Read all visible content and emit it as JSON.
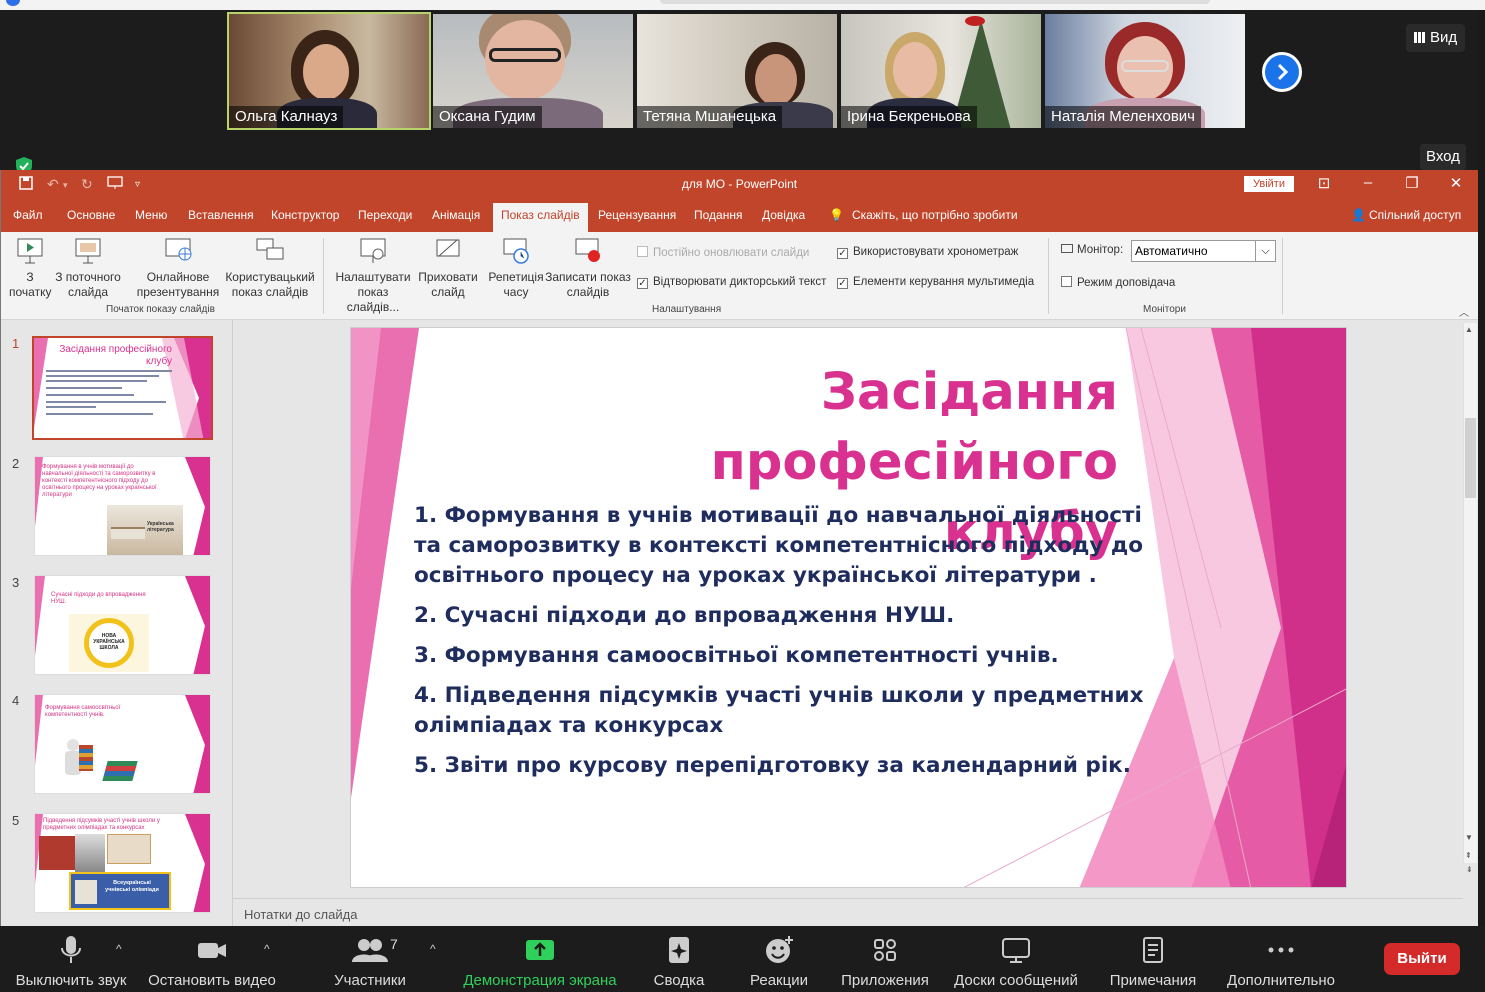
{
  "zoom": {
    "participants": [
      {
        "name": "Ольга Калнауз",
        "active": true
      },
      {
        "name": "Оксана Гудим",
        "active": false
      },
      {
        "name": "Тетяна Мшанецька",
        "active": false
      },
      {
        "name": "Ірина  Бекреньова",
        "active": false
      },
      {
        "name": "Наталія Меленхович",
        "active": false
      }
    ],
    "view_label": "Вид",
    "signin_label": "Вход",
    "toolbar": {
      "mute": "Выключить звук",
      "stop_video": "Остановить видео",
      "participants": "Участники",
      "participants_count": "7",
      "share": "Демонстрация экрана",
      "summary": "Сводка",
      "reactions": "Реакции",
      "apps": "Приложения",
      "boards": "Доски сообщений",
      "notes": "Примечания",
      "more": "Дополнительно",
      "leave": "Выйти"
    }
  },
  "powerpoint": {
    "window_title": "для МО  -  PowerPoint",
    "signin_label": "Увійти",
    "tabs": [
      "Файл",
      "Основне",
      "Меню",
      "Вставлення",
      "Конструктор",
      "Переходи",
      "Анімація",
      "Показ слайдів",
      "Рецензування",
      "Подання",
      "Довідка"
    ],
    "selected_tab": "Показ слайдів",
    "tell_me": "Скажіть, що потрібно зробити",
    "share": "Спільний доступ",
    "ribbon": {
      "from_start": "З\nпочатку",
      "from_current": "З поточного\nслайда",
      "online": "Онлайнове\nпрезентування",
      "custom": "Користувацький\nпоказ слайдів",
      "group_start": "Початок показу слайдів",
      "setup": "Налаштувати\nпоказ слайдів...",
      "hide": "Приховати\nслайд",
      "rehearse": "Репетиція\nчасу",
      "record": "Записати показ\nслайдів",
      "always_update": "Постійно оновлювати слайди",
      "play_narration": "Відтворювати дикторський текст",
      "use_timings": "Використовувати хронометраж",
      "media_controls": "Елементи керування мультимедіа",
      "group_setup": "Налаштування",
      "monitor_label": "Монітор:",
      "monitor_value": "Автоматично",
      "presenter_view": "Режим доповідача",
      "group_monitors": "Монітори"
    },
    "slide_numbers": [
      "1",
      "2",
      "3",
      "4",
      "5"
    ],
    "thumbs": {
      "t1_title": "Засідання професійного клубу",
      "t2": "Формування в учнів мотивації до навчальної діяльності та саморозвитку в контексті компетентнісного підходу до освітнього процесу на уроках української літератури",
      "t2_book": "Українська література",
      "t3": "Сучасні підходи до впровадження НУШ.",
      "t3_logo": "НОВА УКРАЇНСЬКА ШКОЛА",
      "t4": "Формування самоосвітньої компетентності учнів.",
      "t5": "Підведення підсумків участі учнів школи у предметних олімпіадах та конкурсах",
      "t5_badge": "Всеукраїнські учнівські олімпіади"
    },
    "slide": {
      "title_line1": "Засідання професійного",
      "title_line2": "клубу",
      "items": [
        "1.  Формування в учнів мотивації до навчальної діяльності та саморозвитку в контексті компетентнісного підходу до освітнього  процесу на уроках української літератури .",
        "2.  Сучасні підходи до впровадження НУШ.",
        "3.  Формування самоосвітньої компетентності учнів.",
        "4.  Підведення підсумків участі учнів школи у предметних олімпіадах та конкурсах",
        "5.  Звіти про курсову перепідготовку за календарний рік."
      ]
    },
    "notes_placeholder": "Нотатки до слайда"
  },
  "colors": {
    "ppt_accent": "#c1452a",
    "slide_pink": "#d9318f",
    "slide_text": "#1f2d5e",
    "zoom_green": "#2fd05c",
    "leave_red": "#d42a2a"
  }
}
